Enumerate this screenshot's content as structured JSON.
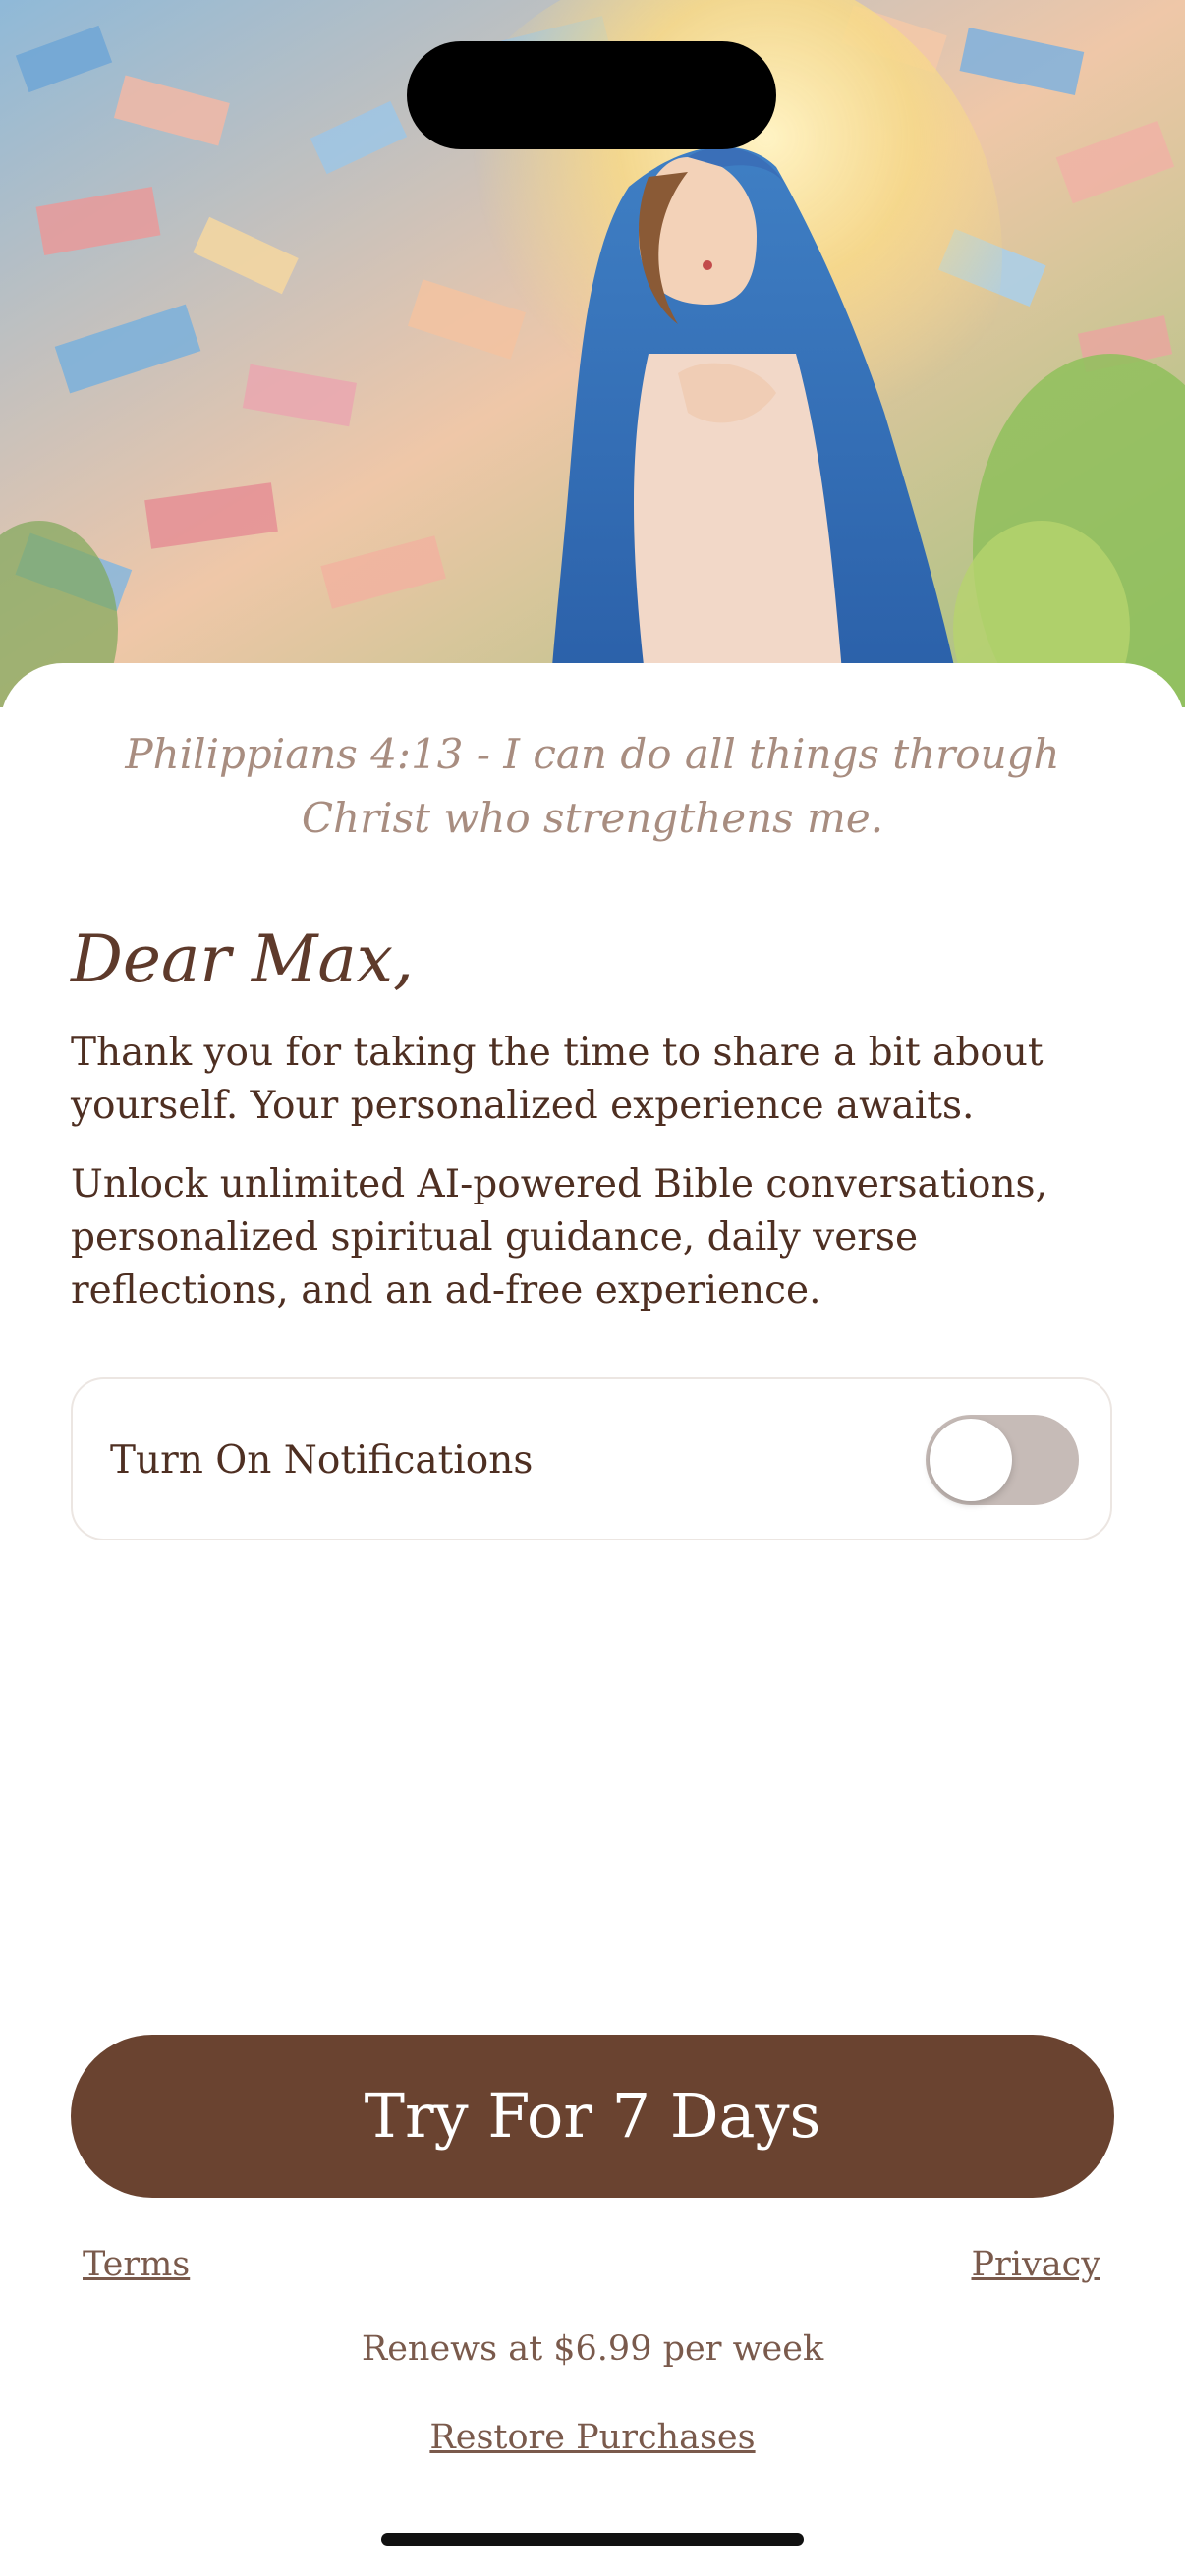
{
  "verse": "Philippians 4:13 - I can do all things through Christ who strengthens me.",
  "greeting": "Dear Max,",
  "paragraphs": {
    "thanks": "Thank you for taking the time to share a bit about yourself. Your personalized experience awaits.",
    "unlock": "Unlock unlimited AI-powered Bible conversations, personalized spiritual guidance, daily verse reflections, and an ad-free experience."
  },
  "notifications": {
    "label": "Turn On Notifications",
    "enabled": false
  },
  "cta_label": "Try For 7 Days",
  "links": {
    "terms": "Terms",
    "privacy": "Privacy",
    "restore": "Restore Purchases"
  },
  "renewal_text": "Renews at $6.99 per week",
  "colors": {
    "primary_brown": "#6a4330",
    "text_brown": "#4e2f22",
    "verse_text": "#a88d80",
    "toggle_off": "#c6bbb7"
  },
  "icons": {
    "hero": "virgin-mary-painting"
  }
}
